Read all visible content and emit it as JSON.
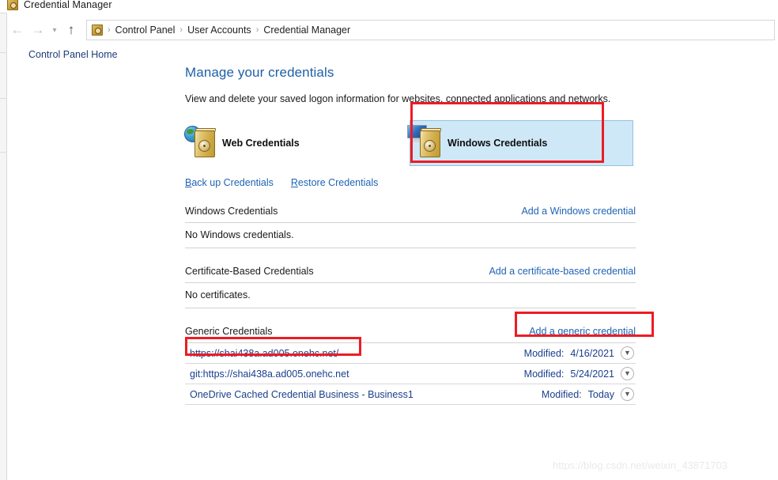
{
  "window": {
    "title": "Credential Manager",
    "title_icon": "vault-icon"
  },
  "nav": {
    "back_icon": "arrow-left-icon",
    "forward_icon": "arrow-right-icon",
    "recent_icon": "chevron-down-icon",
    "up_icon": "arrow-up-icon",
    "breadcrumb_icon": "vault-icon",
    "separator": "›",
    "breadcrumbs": [
      {
        "label": "Control Panel"
      },
      {
        "label": "User Accounts"
      },
      {
        "label": "Credential Manager"
      }
    ]
  },
  "sidebar": {
    "items": [
      {
        "label": "Control Panel Home"
      }
    ]
  },
  "main": {
    "title": "Manage your credentials",
    "description": "View and delete your saved logon information for websites, connected applications and networks.",
    "credential_types": [
      {
        "label": "Web Credentials",
        "icon": "web-credentials-icon",
        "selected": false
      },
      {
        "label": "Windows Credentials",
        "icon": "windows-credentials-icon",
        "selected": true
      }
    ],
    "links": [
      {
        "access_key": "B",
        "rest": "ack up Credentials"
      },
      {
        "access_key": "R",
        "rest": "estore Credentials"
      }
    ],
    "sections": [
      {
        "title": "Windows Credentials",
        "action": "Add a Windows credential",
        "empty_text": "No Windows credentials.",
        "rows": []
      },
      {
        "title": "Certificate-Based Credentials",
        "action": "Add a certificate-based credential",
        "empty_text": "No certificates.",
        "rows": []
      },
      {
        "title": "Generic Credentials",
        "action": "Add a generic credential",
        "empty_text": "",
        "rows": [
          {
            "name": "https://shai438a.ad005.onehc.net/",
            "modified_label": "Modified:",
            "modified_value": "4/16/2021",
            "expand_icon": "chevron-down-icon"
          },
          {
            "name": "git:https://shai438a.ad005.onehc.net",
            "modified_label": "Modified:",
            "modified_value": "5/24/2021",
            "expand_icon": "chevron-down-icon"
          },
          {
            "name": "OneDrive Cached Credential Business - Business1",
            "modified_label": "Modified:",
            "modified_value": "Today",
            "expand_icon": "chevron-down-icon"
          }
        ]
      }
    ]
  },
  "annotations": {
    "color": "#ed1c24",
    "boxes": [
      {
        "target": "windows-credentials-button"
      },
      {
        "target": "add-a-generic-credential-link"
      },
      {
        "target": "first-generic-credential-row"
      }
    ]
  },
  "watermark": {
    "text": "https://blog.csdn.net/weixin_43871703"
  }
}
